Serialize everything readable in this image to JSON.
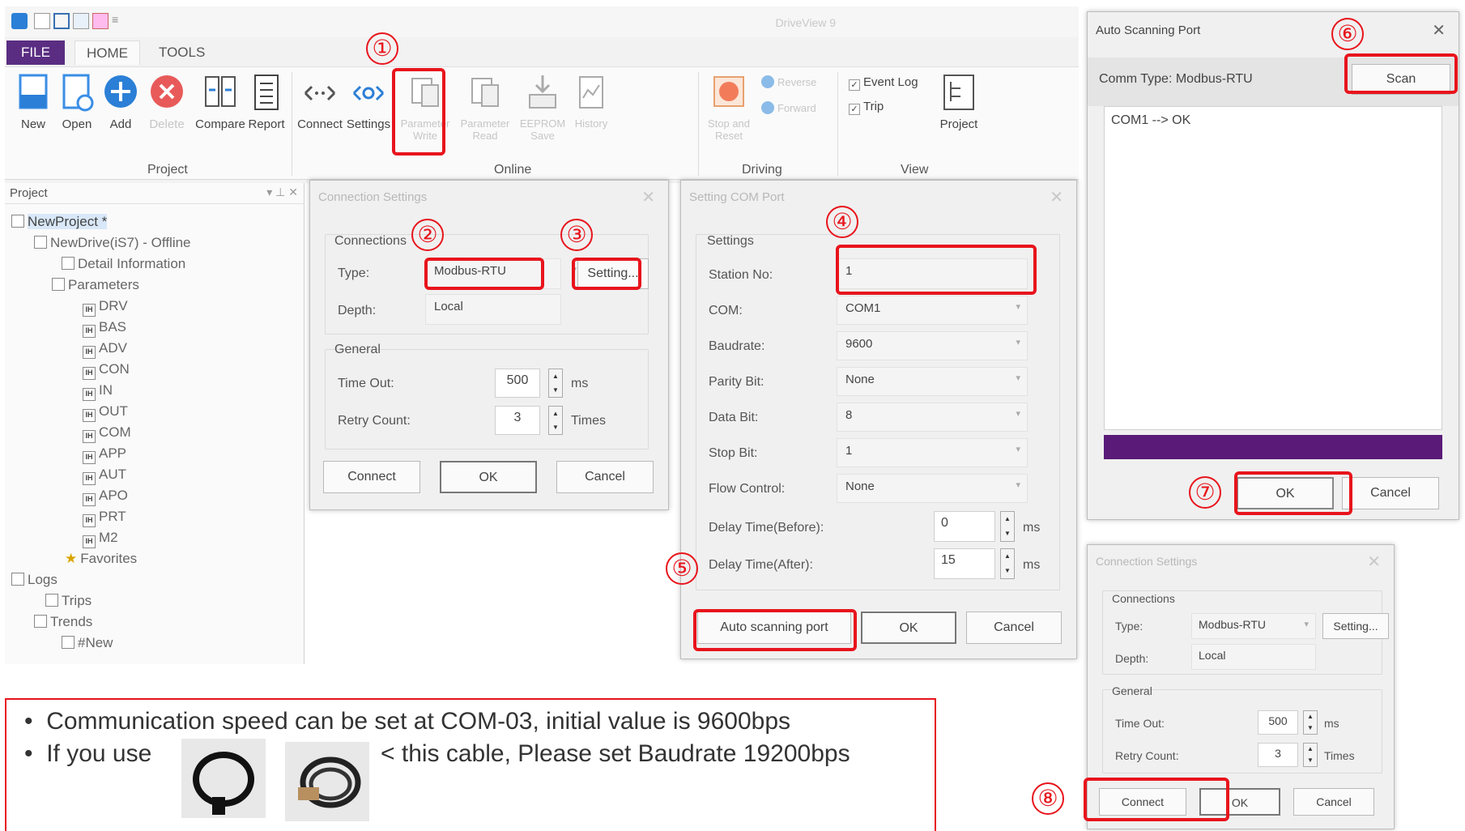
{
  "app": {
    "title": "DriveView 9",
    "menu": {
      "file": "FILE",
      "home": "HOME",
      "tools": "TOOLS"
    },
    "ribbon": {
      "project": {
        "label": "Project",
        "buttons": [
          "New",
          "Open",
          "Add",
          "Delete",
          "Compare",
          "Report"
        ]
      },
      "online": {
        "label": "Online",
        "buttons": [
          "Connect",
          "Settings",
          "Parameter Write",
          "Parameter Read",
          "EEPROM Save",
          "History"
        ]
      },
      "driving": {
        "label": "Driving",
        "stop": "Stop and Reset",
        "reverse": "Reverse",
        "forward": "Forward"
      },
      "view": {
        "label": "View",
        "event_log": "Event Log",
        "trip": "Trip",
        "project": "Project"
      }
    },
    "tree": {
      "header": "Project",
      "items": [
        "NewProject *",
        "NewDrive(iS7) - Offline",
        "Detail Information",
        "Parameters",
        "DRV",
        "BAS",
        "ADV",
        "CON",
        "IN",
        "OUT",
        "COM",
        "APP",
        "AUT",
        "APO",
        "PRT",
        "M2",
        "Favorites",
        "Logs",
        "Trips",
        "Trends",
        "#New"
      ]
    }
  },
  "connection_dialog": {
    "title": "Connection Settings",
    "connections_label": "Connections",
    "type_label": "Type:",
    "type_value": "Modbus-RTU",
    "setting_button": "Setting...",
    "depth_label": "Depth:",
    "depth_value": "Local",
    "general_label": "General",
    "timeout_label": "Time Out:",
    "timeout_value": "500",
    "timeout_unit": "ms",
    "retry_label": "Retry Count:",
    "retry_value": "3",
    "retry_unit": "Times",
    "connect": "Connect",
    "ok": "OK",
    "cancel": "Cancel"
  },
  "com_dialog": {
    "title": "Setting COM Port",
    "settings_label": "Settings",
    "station_label": "Station No:",
    "station_value": "1",
    "com_label": "COM:",
    "com_value": "COM1",
    "baud_label": "Baudrate:",
    "baud_value": "9600",
    "parity_label": "Parity Bit:",
    "parity_value": "None",
    "data_label": "Data Bit:",
    "data_value": "8",
    "stop_label": "Stop Bit:",
    "stop_value": "1",
    "flow_label": "Flow Control:",
    "flow_value": "None",
    "delay_before_label": "Delay Time(Before):",
    "delay_before_value": "0",
    "delay_after_label": "Delay Time(After):",
    "delay_after_value": "15",
    "ms": "ms",
    "auto_scan": "Auto scanning port",
    "ok": "OK",
    "cancel": "Cancel"
  },
  "scan_dialog": {
    "title": "Auto Scanning Port",
    "comm_type": "Comm Type: Modbus-RTU",
    "scan": "Scan",
    "result": "COM1 --> OK",
    "progress": 1.0,
    "ok": "OK",
    "cancel": "Cancel"
  },
  "small_dialog": {
    "title": "Connection Settings",
    "connections_label": "Connections",
    "type_label": "Type:",
    "type_value": "Modbus-RTU",
    "setting_button": "Setting...",
    "depth_label": "Depth:",
    "depth_value": "Local",
    "general_label": "General",
    "timeout_label": "Time Out:",
    "timeout_value": "500",
    "timeout_unit": "ms",
    "retry_label": "Retry Count:",
    "retry_value": "3",
    "retry_unit": "Times",
    "connect": "Connect",
    "ok": "OK",
    "cancel": "Cancel"
  },
  "steps": [
    "①",
    "②",
    "③",
    "④",
    "⑤",
    "⑥",
    "⑦",
    "⑧"
  ],
  "note": {
    "line1": "Communication speed can be set at COM-03, initial value is 9600bps",
    "line2_prefix": "If you use",
    "line2_suffix": "< this cable, Please set Baudrate 19200bps"
  },
  "colors": {
    "highlight": "#e8141c",
    "file_tab": "#5a2d82",
    "progress": "#5a1a78",
    "accent_blue": "#2b7fd6"
  }
}
